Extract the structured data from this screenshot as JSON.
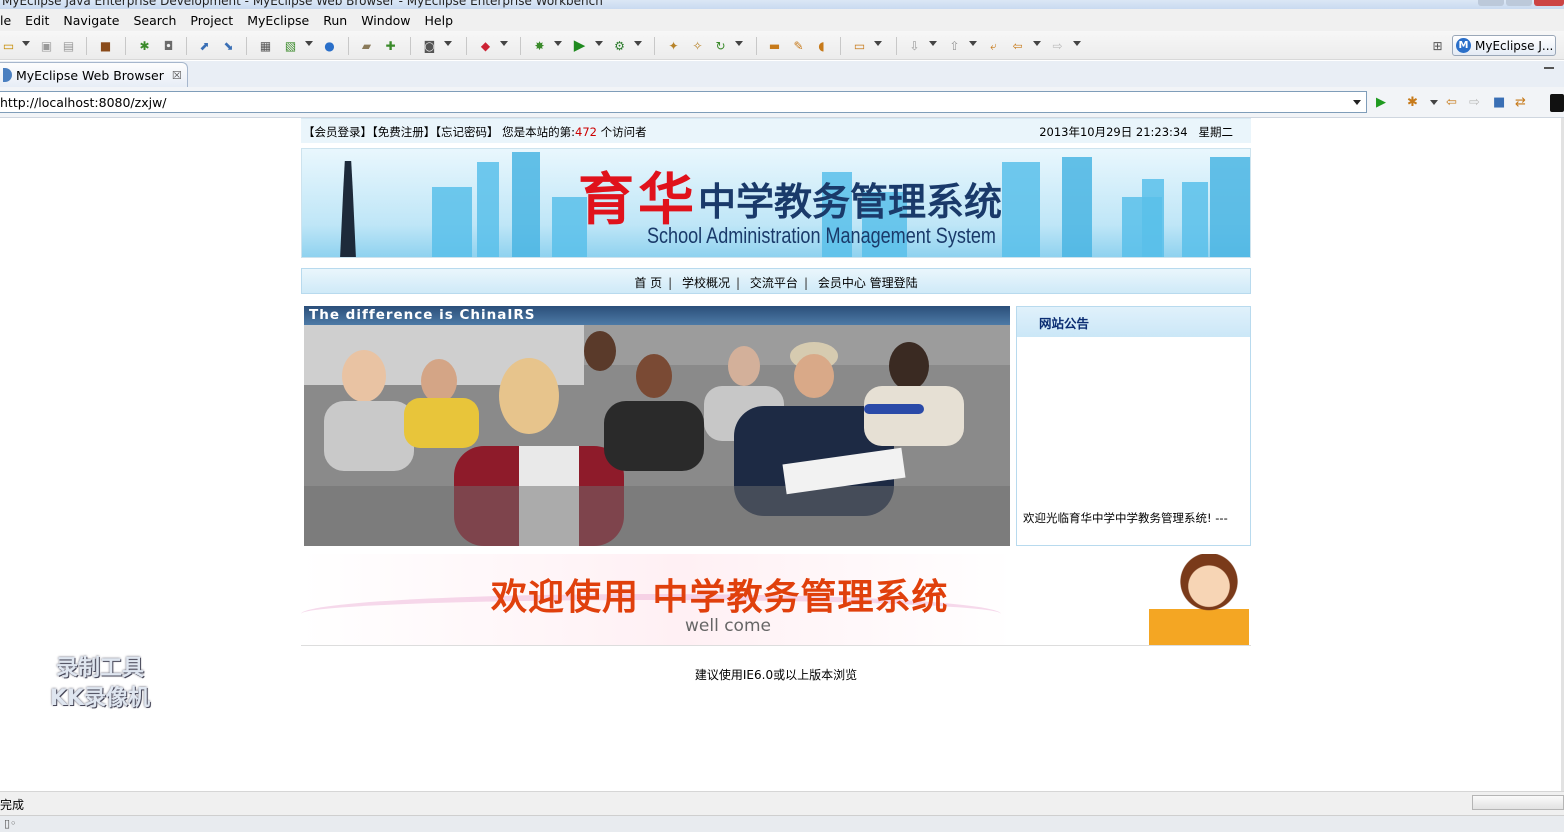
{
  "window": {
    "title": "MyEclipse Java Enterprise Development - MyEclipse Web Browser - MyEclipse Enterprise Workbench"
  },
  "menu": [
    "le",
    "Edit",
    "Navigate",
    "Search",
    "Project",
    "MyEclipse",
    "Run",
    "Window",
    "Help"
  ],
  "toolbar": {
    "perspective_label": "MyEclipse J...",
    "perspective_icon": "M"
  },
  "tab": {
    "label": "MyEclipse Web Browser",
    "close": "☒"
  },
  "browser": {
    "url": "http://localhost:8080/zxjw/"
  },
  "site": {
    "topbar": {
      "links": "【会员登录】【免费注册】【忘记密码】",
      "visitor_prefix": "您是本站的第:",
      "visitor_count": "472",
      "visitor_suffix": "个访问者",
      "datetime": "2013年10月29日 21:23:34",
      "weekday": "星期二"
    },
    "banner": {
      "brand": "育华",
      "title": "中学教务管理系统",
      "subtitle": "School Administration Management System"
    },
    "nav": [
      "首 页",
      "学校概况",
      "交流平台",
      "会员中心",
      "管理登陆"
    ],
    "photo": {
      "caption": "The difference is ChinaIRS"
    },
    "notice": {
      "heading": "网站公告",
      "text": "欢迎光临育华中学中学教务管理系统! ---"
    },
    "welcome": {
      "title": "欢迎使用 中学教务管理系统",
      "subtitle": "well come"
    },
    "footer": "建议使用IE6.0或以上版本浏览"
  },
  "watermark": {
    "line1": "录制工具",
    "line2": "KK录像机"
  },
  "status": {
    "text": "完成"
  },
  "colors": {
    "accent_red": "#e0121b",
    "nav_blue": "#cfeaf8",
    "welcome_orange": "#e0400c"
  }
}
